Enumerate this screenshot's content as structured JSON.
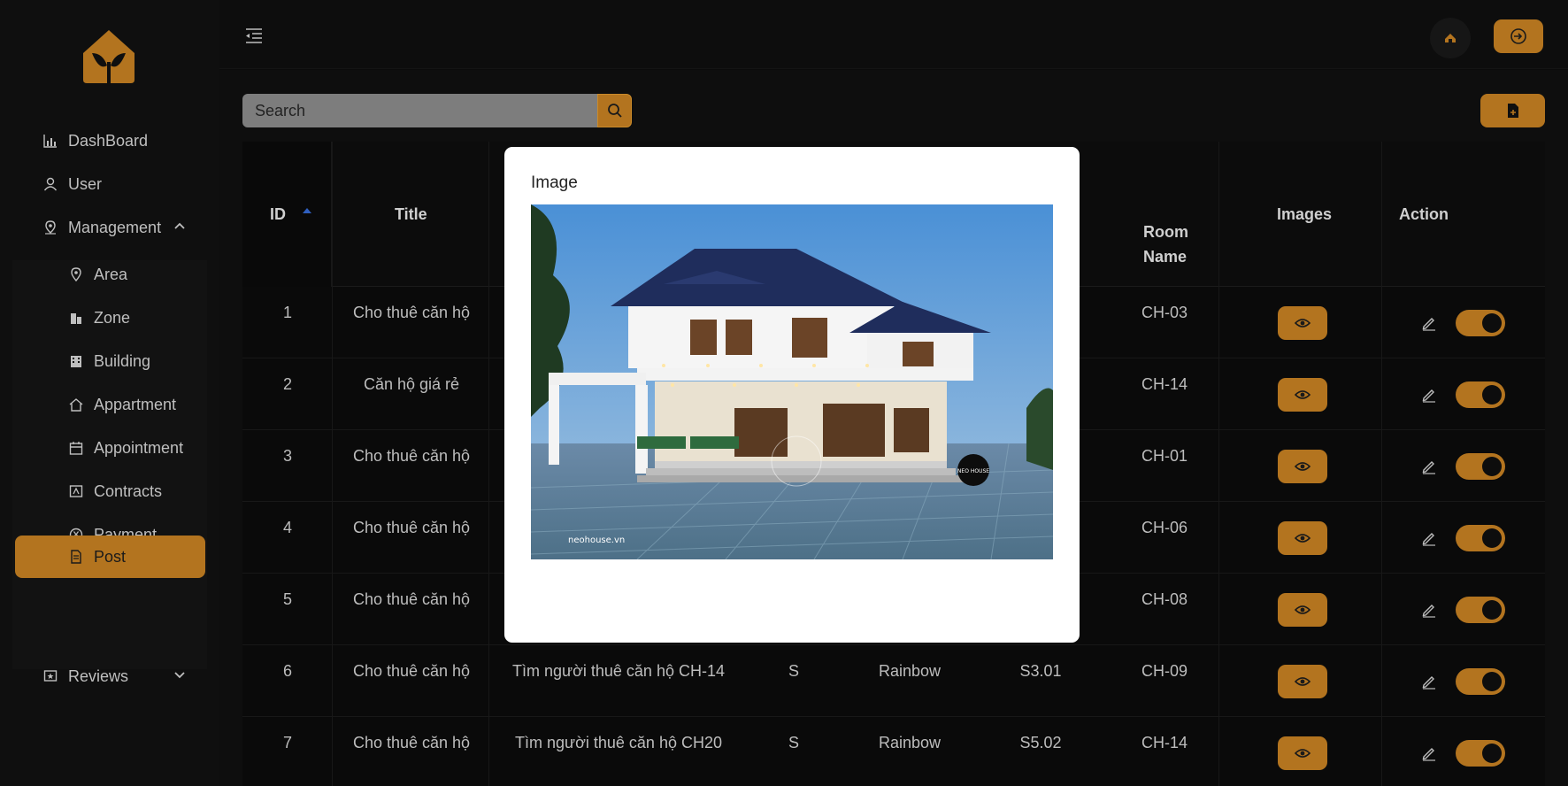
{
  "sidebar": {
    "logo": "house-leaf-logo",
    "items": [
      {
        "label": "DashBoard",
        "icon": "bar-chart-icon"
      },
      {
        "label": "User",
        "icon": "user-icon"
      },
      {
        "label": "Management",
        "icon": "location-pin-icon"
      },
      {
        "label": "Area",
        "icon": "location-pin-icon"
      },
      {
        "label": "Zone",
        "icon": "buildings-icon"
      },
      {
        "label": "Building",
        "icon": "office-building-icon"
      },
      {
        "label": "Appartment",
        "icon": "home-icon"
      },
      {
        "label": "Appointment",
        "icon": "calendar-icon"
      },
      {
        "label": "Contracts",
        "icon": "contract-icon"
      },
      {
        "label": "Payment",
        "icon": "yen-coin-icon"
      },
      {
        "label": "Post",
        "icon": "document-icon"
      },
      {
        "label": "Reviews",
        "icon": "star-card-icon"
      }
    ]
  },
  "search": {
    "placeholder": "Search"
  },
  "table": {
    "headers": {
      "id": "ID",
      "title": "Title",
      "room_name_1": "Room",
      "room_name_2": "Name",
      "images": "Images",
      "action": "Action"
    },
    "rows": [
      {
        "id": "1",
        "title": "Cho thuê căn hộ",
        "description": "",
        "type": "",
        "building": "",
        "code": "",
        "room": "CH-03",
        "enabled": true
      },
      {
        "id": "2",
        "title": "Căn hộ giá rẻ",
        "description": "",
        "type": "",
        "building": "",
        "code": "",
        "room": "CH-14",
        "enabled": true
      },
      {
        "id": "3",
        "title": "Cho thuê căn hộ",
        "description": "",
        "type": "",
        "building": "",
        "code": "",
        "room": "CH-01",
        "enabled": true
      },
      {
        "id": "4",
        "title": "Cho thuê căn hộ",
        "description": "",
        "type": "",
        "building": "",
        "code": "",
        "room": "CH-06",
        "enabled": true
      },
      {
        "id": "5",
        "title": "Cho thuê căn hộ",
        "description": "",
        "type": "",
        "building": "",
        "code": "",
        "room": "CH-08",
        "enabled": true
      },
      {
        "id": "6",
        "title": "Cho thuê căn hộ",
        "description": "Tìm người thuê căn hộ CH-14",
        "type": "S",
        "building": "Rainbow",
        "code": "S3.01",
        "room": "CH-09",
        "enabled": true
      },
      {
        "id": "7",
        "title": "Cho thuê căn hộ",
        "description": "Tìm người thuê căn hộ CH20",
        "type": "S",
        "building": "Rainbow",
        "code": "S5.02",
        "room": "CH-14",
        "enabled": true
      }
    ]
  },
  "modal": {
    "title": "Image",
    "watermark": "neohouse.vn",
    "badge": "NEO HOUSE"
  },
  "colors": {
    "accent": "#b3741f",
    "background": "#0b0b0b",
    "modal": "#ffffff"
  }
}
